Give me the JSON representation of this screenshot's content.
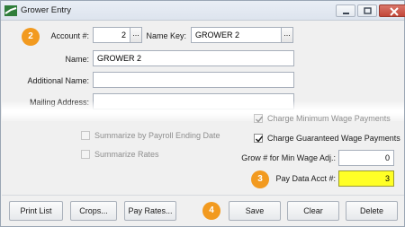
{
  "window": {
    "title": "Grower Entry"
  },
  "form": {
    "account_label": "Account #:",
    "account_value": "2",
    "name_key_label": "Name Key:",
    "name_key_value": "GROWER 2",
    "name_label": "Name:",
    "name_value": "GROWER 2",
    "additional_name_label": "Additional Name:",
    "additional_name_value": "",
    "mailing_address_label": "Mailing Address:",
    "ellipsis": "...",
    "charge_min_wage_label": "Charge Minimum Wage Payments",
    "summarize_payroll_label": "Summarize by Payroll Ending Date",
    "charge_guaranteed_label": "Charge Guaranteed Wage Payments",
    "summarize_rates_label": "Summarize Rates",
    "grow_min_wage_label": "Grow # for Min Wage Adj.:",
    "grow_min_wage_value": "0",
    "pay_data_acct_label": "Pay Data Acct #:",
    "pay_data_acct_value": "3"
  },
  "checkboxes": {
    "charge_min_wage_checked": true,
    "summarize_payroll_checked": false,
    "charge_guaranteed_checked": true,
    "summarize_rates_checked": false
  },
  "callouts": [
    "2",
    "3",
    "4"
  ],
  "buttons": {
    "print_list": "Print List",
    "crops": "Crops...",
    "pay_rates": "Pay Rates...",
    "save": "Save",
    "clear": "Clear",
    "delete": "Delete"
  },
  "colors": {
    "callout": "#f29a1f",
    "highlight_field": "#ffff26",
    "close_button": "#c2473a"
  },
  "icons": {
    "app": "green-arrow-icon",
    "minimize": "minimize-icon",
    "maximize": "maximize-icon",
    "close": "close-icon",
    "check": "checkmark-icon"
  }
}
